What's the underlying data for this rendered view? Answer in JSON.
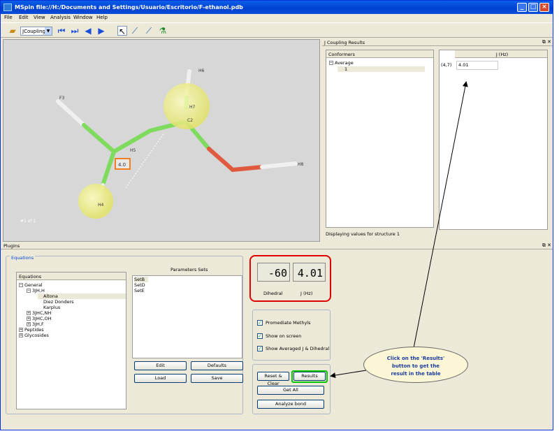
{
  "window": {
    "title": "MSpin file://H:/Documents and Settings/Usuario/Escritorio/F-ethanol.pdb"
  },
  "menu": [
    "File",
    "Edit",
    "View",
    "Analysis",
    "Window",
    "Help"
  ],
  "toolbar": {
    "mode": "JCoupling",
    "icons": [
      "open-folder-icon",
      "first-icon",
      "next-icon",
      "previous-icon",
      "play-icon",
      "pointer-icon",
      "measure-icon",
      "bond-icon",
      "structure-icon"
    ]
  },
  "viewer": {
    "atoms": {
      "f3": "F3",
      "h6": "H6",
      "h7": "H7",
      "c2": "C2",
      "h5": "H5",
      "h8": "H8",
      "h4": "H4"
    },
    "jlabel": "4.0",
    "frame": "#1 of 1"
  },
  "jcoupling_panel": {
    "title": "J Coupling Results",
    "conformers_header": "Conformers",
    "tree": {
      "parent": "Average",
      "child": "1"
    },
    "j_header": "J (Hz)",
    "row": {
      "pair": "(4,7)",
      "value": "4.01"
    },
    "status": "Displaying values for structure 1"
  },
  "plugins": {
    "title": "Plugins",
    "tab": "Equations",
    "equations_header": "Equations",
    "tree": {
      "general": "General",
      "jhh": "3JH,H",
      "altona": "Altona",
      "diez": "Diez Donders",
      "karplus": "Karplus",
      "jhcnh": "3JHC,NH",
      "jhcoh": "3JHC,OH",
      "jhf": "3JH,F",
      "peptides": "Peptides",
      "glycosides": "Glycosides"
    },
    "params_label": "Parameters Sets",
    "params": [
      "SetB",
      "SetD",
      "SetE"
    ],
    "buttons": {
      "edit": "Edit",
      "defaults": "Defaults",
      "load": "Load",
      "save": "Save"
    },
    "readout": {
      "dihedral_value": "-60",
      "j_value": "4.01",
      "dihedral_label": "Dihedral",
      "j_label": "J (Hz)"
    },
    "options": {
      "promediate": "Promediate Methyls",
      "show_screen": "Show on screen",
      "show_averaged": "Show Averaged J & Dihedral"
    },
    "actions": {
      "reset": "Reset & Clear",
      "results": "Results",
      "get_all": "Get All",
      "analyze": "Analyze bond"
    }
  },
  "annotation": {
    "callout_l1": "Click on the 'Results'",
    "callout_l2": "button to get the",
    "callout_l3": "result in the table"
  }
}
